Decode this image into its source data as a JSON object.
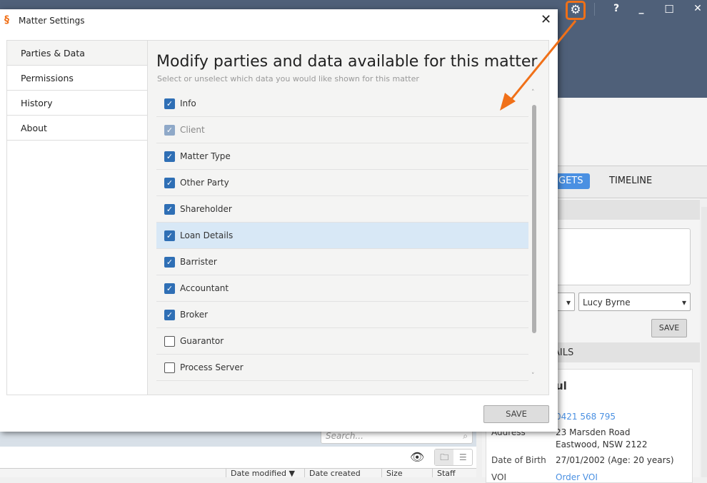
{
  "app": {
    "tabs": [
      {
        "label": "GETS",
        "active": true
      },
      {
        "label": "TIMELINE"
      }
    ],
    "window_controls": {
      "settings": "gear-icon",
      "help": "?",
      "minimize": "_",
      "maximize": "☐",
      "close": "✕"
    },
    "assignee": "Lucy Byrne",
    "save_label": "SAVE",
    "details_header": "AILS",
    "contact": {
      "name_partial": "ul",
      "phone": "0421 568 795",
      "address_label": "Address",
      "address_line1": "23 Marsden Road",
      "address_line2": "Eastwood, NSW 2122",
      "dob_label": "Date of Birth",
      "dob": "27/01/2002 (Age: 20 years)",
      "voi_label": "VOI",
      "voi_value": "Order VOI"
    },
    "search_placeholder": "Search...",
    "columns": [
      "",
      "Date modified ▼",
      "Date created",
      "Size",
      "Staff"
    ]
  },
  "dialog": {
    "title": "Matter Settings",
    "close": "✕",
    "nav": [
      {
        "label": "Parties & Data",
        "active": true
      },
      {
        "label": "Permissions"
      },
      {
        "label": "History"
      },
      {
        "label": "About"
      }
    ],
    "heading": "Modify parties and data available for this matter",
    "subheading": "Select or unselect which data you would like shown for this matter",
    "items": [
      {
        "label": "Info",
        "checked": true
      },
      {
        "label": "Client",
        "checked": true,
        "disabled": true
      },
      {
        "label": "Matter Type",
        "checked": true
      },
      {
        "label": "Other Party",
        "checked": true
      },
      {
        "label": "Shareholder",
        "checked": true
      },
      {
        "label": "Loan Details",
        "checked": true,
        "highlighted": true
      },
      {
        "label": "Barrister",
        "checked": true
      },
      {
        "label": "Accountant",
        "checked": true
      },
      {
        "label": "Broker",
        "checked": true
      },
      {
        "label": "Guarantor",
        "checked": false
      },
      {
        "label": "Process Server",
        "checked": false
      }
    ],
    "save_label": "SAVE"
  },
  "colors": {
    "accent": "#f07018",
    "checkbox": "#2f6fb5",
    "titlebar": "#4f6079",
    "tab_active": "#4a90e2"
  }
}
